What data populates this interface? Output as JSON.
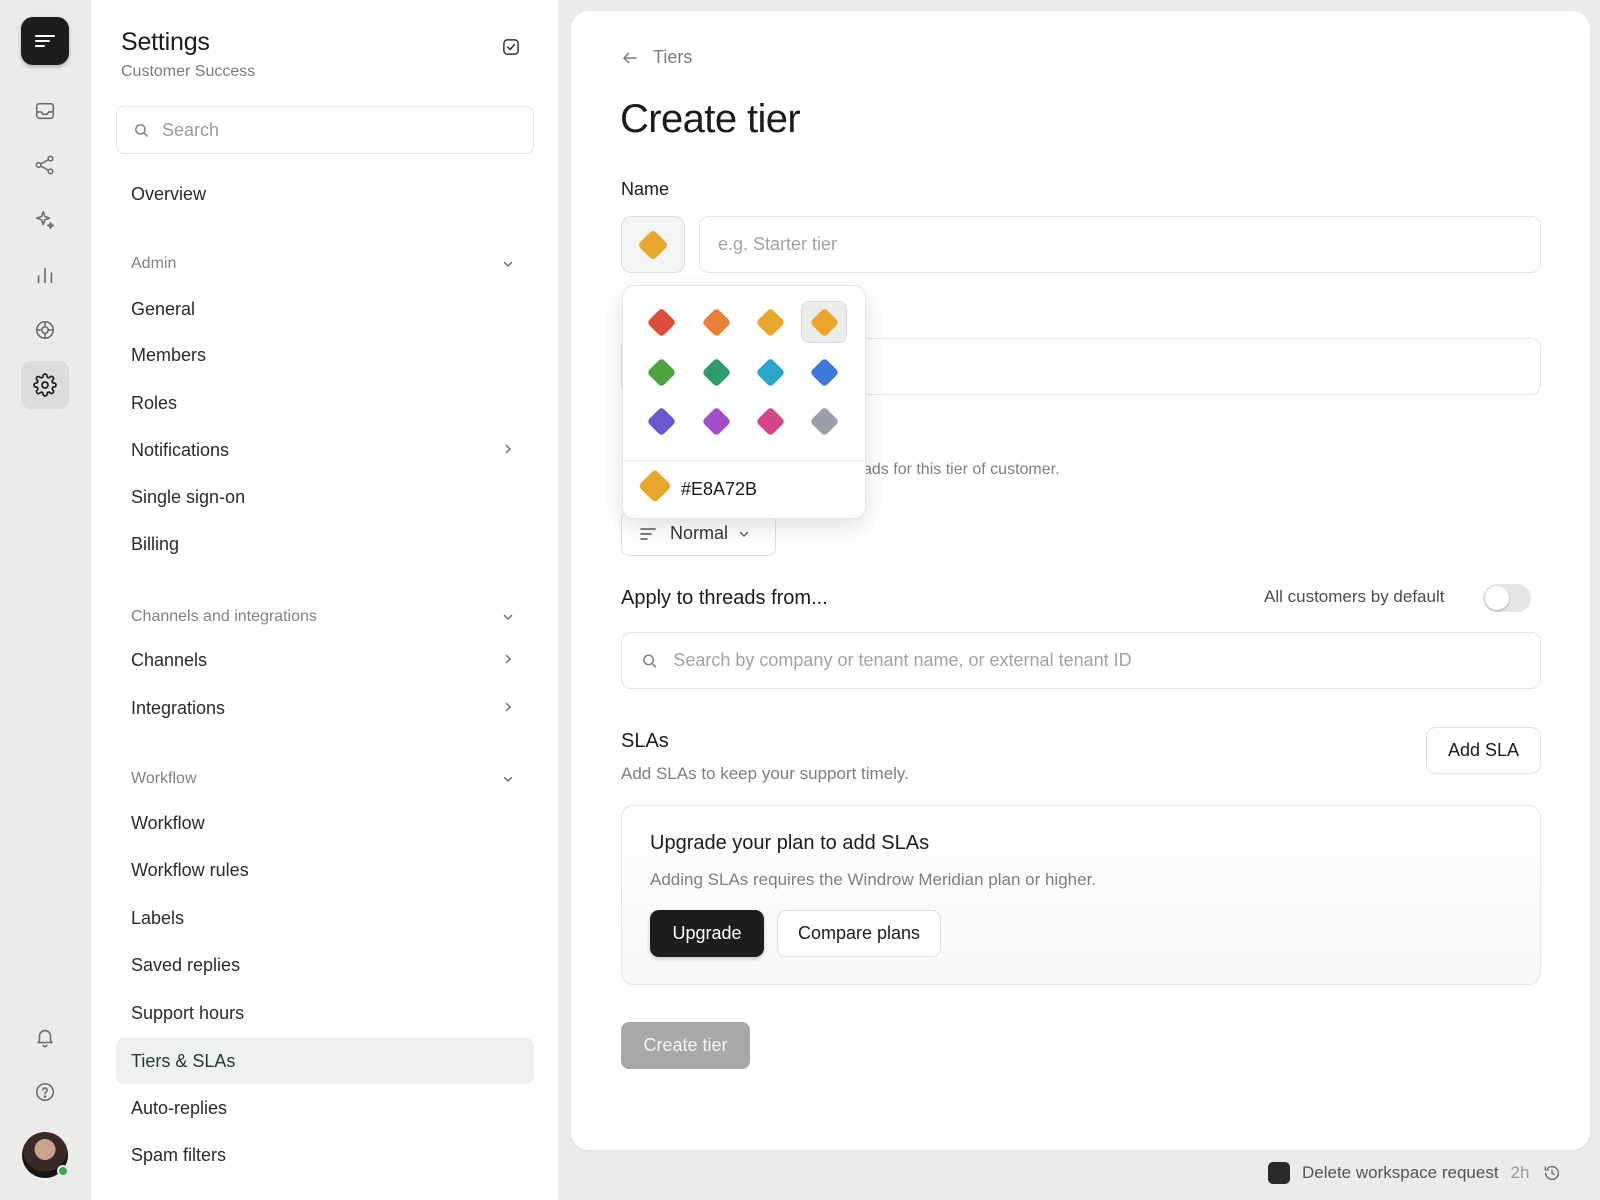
{
  "sidebar": {
    "title": "Settings",
    "subtitle": "Customer Success",
    "search_placeholder": "Search",
    "overview": "Overview",
    "sections": {
      "admin": "Admin",
      "channels": "Channels and integrations",
      "workflow": "Workflow"
    },
    "items": {
      "general": "General",
      "members": "Members",
      "roles": "Roles",
      "notifications": "Notifications",
      "sso": "Single sign-on",
      "billing": "Billing",
      "channels": "Channels",
      "integrations": "Integrations",
      "workflow": "Workflow",
      "workflow_rules": "Workflow rules",
      "labels": "Labels",
      "saved_replies": "Saved replies",
      "support_hours": "Support hours",
      "tiers": "Tiers & SLAs",
      "auto_replies": "Auto-replies",
      "spam_filters": "Spam filters"
    }
  },
  "main": {
    "breadcrumb": "Tiers",
    "title": "Create tier",
    "name_label": "Name",
    "name_placeholder": "e.g. Starter tier",
    "selected_color": "#E8A72B",
    "help_fragment": "ads for this tier of customer.",
    "priority_value": "Normal",
    "apply_heading": "Apply to threads from...",
    "default_label": "All customers by default",
    "default_enabled": false,
    "search_placeholder": "Search by company or tenant name, or external tenant ID",
    "slas": {
      "heading": "SLAs",
      "subtitle": "Add SLAs to keep your support timely.",
      "add_label": "Add SLA",
      "upgrade_title": "Upgrade your plan to add SLAs",
      "upgrade_subtitle": "Adding SLAs requires the Windrow Meridian plan or higher.",
      "upgrade_label": "Upgrade",
      "compare_label": "Compare plans"
    },
    "create_label": "Create tier"
  },
  "color_picker": {
    "colors": [
      "#DD4B3A",
      "#E9803A",
      "#E8A72B",
      "#E8A72B",
      "#4CA33F",
      "#2E9A6E",
      "#2BA6C6",
      "#3E78DA",
      "#6B57CF",
      "#A04FC9",
      "#D34689",
      "#9A9EA8"
    ],
    "selected_index": 3,
    "hex_value": "#E8A72B"
  },
  "status_bar": {
    "label": "Delete workspace request",
    "time": "2h"
  }
}
